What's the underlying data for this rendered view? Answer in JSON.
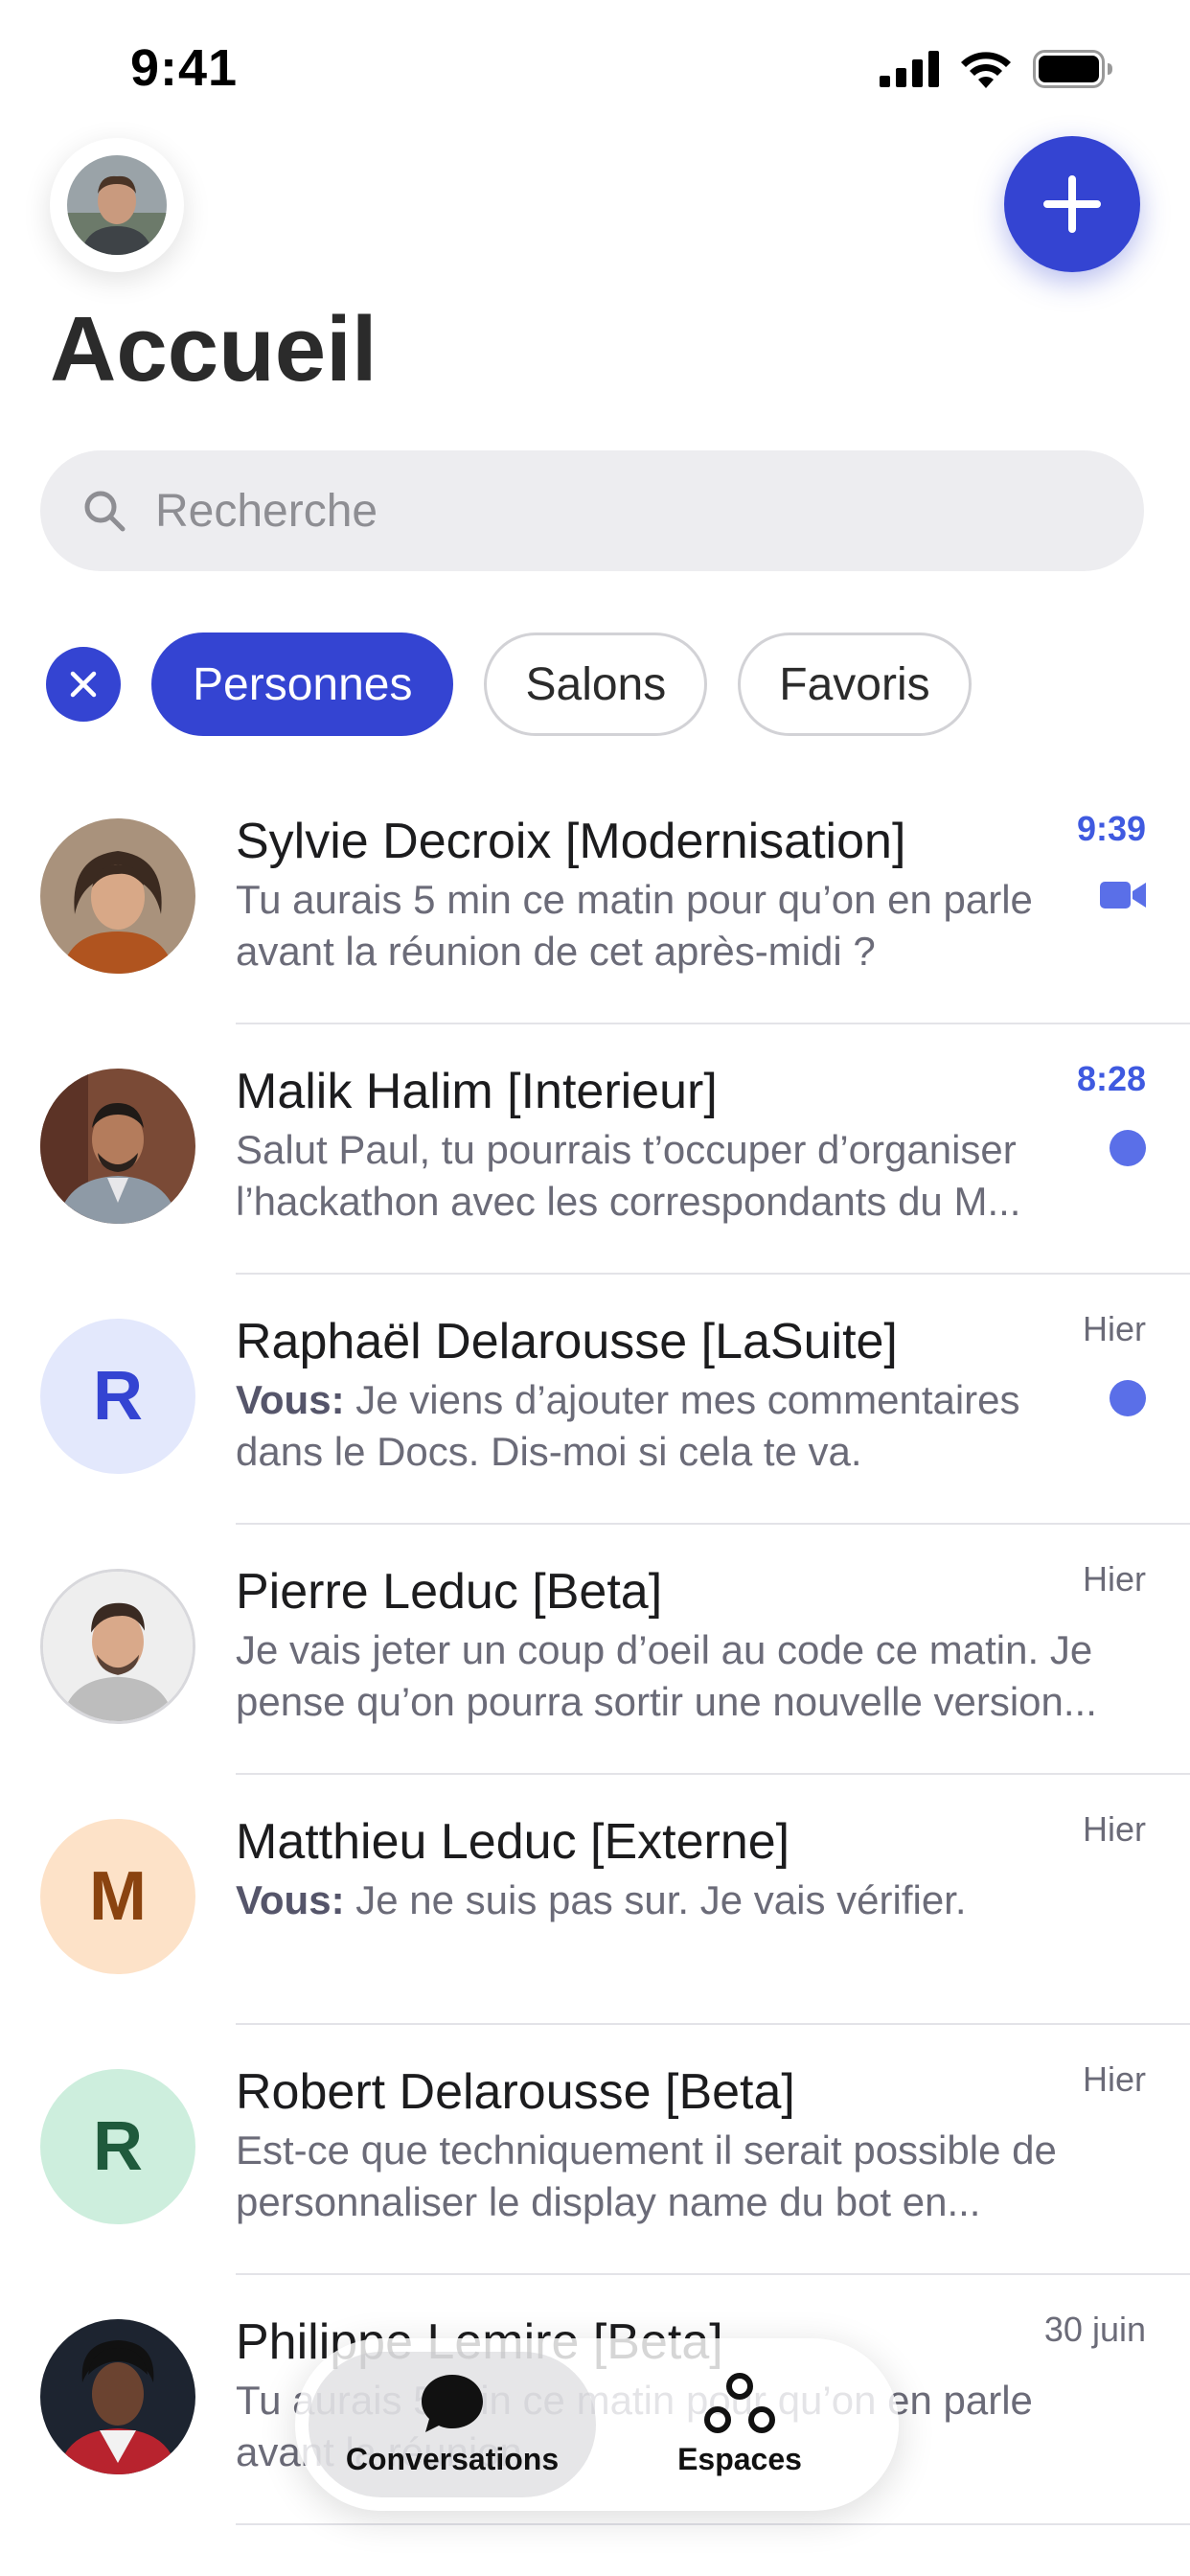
{
  "status_bar": {
    "time": "9:41",
    "icons": [
      "cellular-signal-icon",
      "wifi-icon",
      "battery-icon"
    ]
  },
  "header": {
    "title": "Accueil",
    "compose_icon": "plus-icon",
    "accent_color": "#3444d2"
  },
  "search": {
    "placeholder": "Recherche",
    "value": ""
  },
  "filters": {
    "clear_icon": "close-icon",
    "chips": [
      {
        "label": "Personnes",
        "active": true
      },
      {
        "label": "Salons",
        "active": false
      },
      {
        "label": "Favoris",
        "active": false
      }
    ]
  },
  "conversations": [
    {
      "name": "Sylvie Decroix [Modernisation]",
      "preview_prefix": "",
      "preview": "Tu aurais 5 min ce matin pour qu’on en parle avant la réunion de cet après-midi ?",
      "time": "9:39",
      "unread": true,
      "indicator": "video-camera-icon",
      "avatar": {
        "type": "photo"
      }
    },
    {
      "name": "Malik Halim [Interieur]",
      "preview_prefix": "",
      "preview": "Salut Paul, tu pourrais t’occuper d’organiser l’hackathon avec les correspondants du M...",
      "time": "8:28",
      "unread": true,
      "indicator": "unread-dot",
      "avatar": {
        "type": "photo"
      }
    },
    {
      "name": "Raphaël Delarousse [LaSuite]",
      "preview_prefix": "Vous:",
      "preview": " Je viens d’ajouter mes commentaires dans le Docs. Dis-moi si cela te va.",
      "time": "Hier",
      "unread": false,
      "indicator": "unread-dot",
      "avatar": {
        "type": "initial",
        "letter": "R",
        "bg": "#e3e8fc",
        "fg": "#3444d2"
      }
    },
    {
      "name": "Pierre Leduc [Beta]",
      "preview_prefix": "",
      "preview": "Je vais jeter un coup d’oeil au code ce matin. Je pense qu’on pourra sortir une nouvelle version...",
      "time": "Hier",
      "unread": false,
      "indicator": "",
      "avatar": {
        "type": "photo"
      }
    },
    {
      "name": "Matthieu Leduc [Externe]",
      "preview_prefix": "Vous:",
      "preview": " Je ne suis pas sur. Je vais vérifier.",
      "time": "Hier",
      "unread": false,
      "indicator": "",
      "avatar": {
        "type": "initial",
        "letter": "M",
        "bg": "#fde2c8",
        "fg": "#8a4310"
      }
    },
    {
      "name": "Robert Delarousse [Beta]",
      "preview_prefix": "",
      "preview": "Est-ce que techniquement il serait possible de personnaliser le display name du bot en...",
      "time": "Hier",
      "unread": false,
      "indicator": "",
      "avatar": {
        "type": "initial",
        "letter": "R",
        "bg": "#cdeedd",
        "fg": "#1f5a3c"
      }
    },
    {
      "name": "Philippe Lemire [Beta]",
      "preview_prefix": "",
      "preview": "Tu aurais 5 min ce matin pour qu’on en parle avant la réunion...",
      "time": "30 juin",
      "unread": false,
      "indicator": "",
      "avatar": {
        "type": "photo"
      }
    }
  ],
  "tab_bar": {
    "tabs": [
      {
        "label": "Conversations",
        "icon": "chat-bubble-icon",
        "active": true
      },
      {
        "label": "Espaces",
        "icon": "spaces-icon",
        "active": false
      }
    ]
  }
}
